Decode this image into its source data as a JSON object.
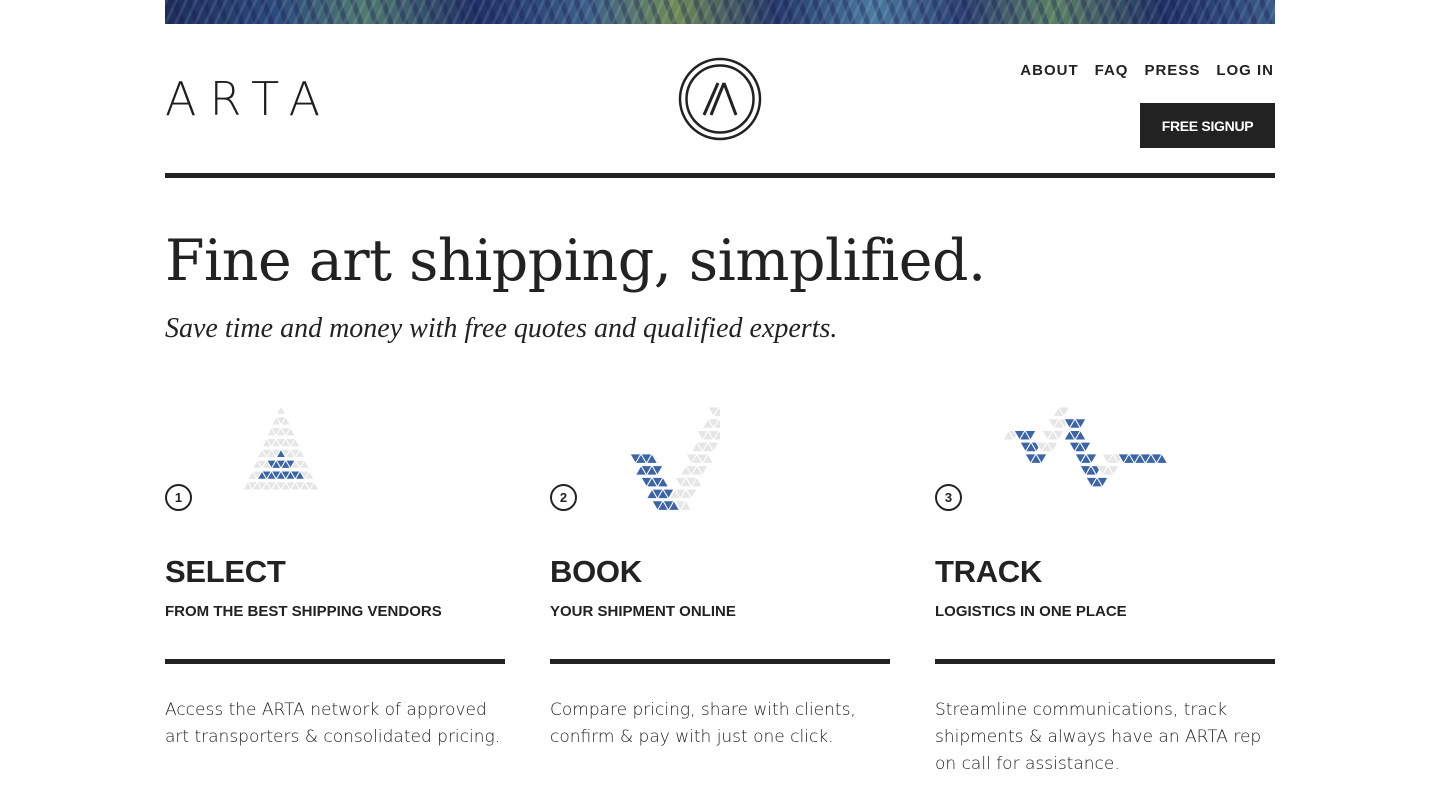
{
  "brand": {
    "logo_text": "ARTA"
  },
  "nav": {
    "items": [
      "ABOUT",
      "FAQ",
      "PRESS",
      "LOG IN"
    ]
  },
  "signup_button": {
    "label": "FREE SIGNUP"
  },
  "hero": {
    "title": "Fine art shipping, simplified.",
    "subtitle": "Save time and money with free quotes and qualified experts."
  },
  "steps": [
    {
      "number": "1",
      "title": "SELECT",
      "subtitle": "FROM THE BEST SHIPPING VENDORS",
      "description": "Access the ARTA network of approved art transporters & consolidated pricing.",
      "icon": "triangle-mosaic-icon"
    },
    {
      "number": "2",
      "title": "BOOK",
      "subtitle": "YOUR SHIPMENT ONLINE",
      "description": "Compare pricing, share with clients, confirm & pay with just one click.",
      "icon": "checkmark-mosaic-icon"
    },
    {
      "number": "3",
      "title": "TRACK",
      "subtitle": "LOGISTICS IN ONE PLACE",
      "description": "Streamline communications, track shipments & always have an ARTA rep on call for assistance.",
      "icon": "pulse-mosaic-icon"
    }
  ],
  "colors": {
    "ink": "#222222",
    "accent_blue": "#3c64a8",
    "tile_grey": "#e6e6e6"
  }
}
